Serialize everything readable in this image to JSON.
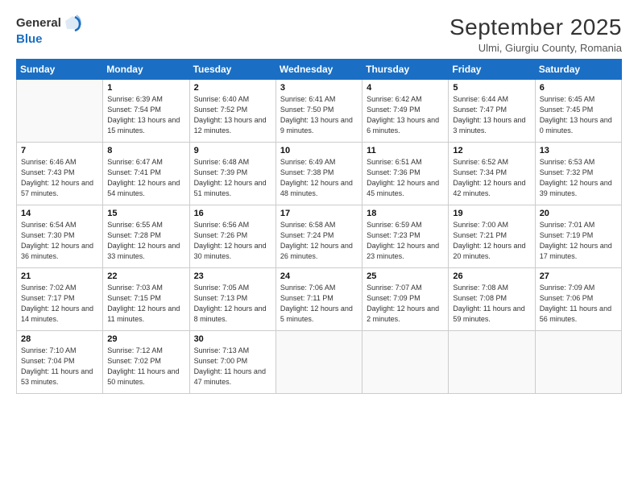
{
  "logo": {
    "general": "General",
    "blue": "Blue"
  },
  "title": {
    "month": "September 2025",
    "location": "Ulmi, Giurgiu County, Romania"
  },
  "weekdays": [
    "Sunday",
    "Monday",
    "Tuesday",
    "Wednesday",
    "Thursday",
    "Friday",
    "Saturday"
  ],
  "weeks": [
    [
      {
        "day": "",
        "sunrise": "",
        "sunset": "",
        "daylight": ""
      },
      {
        "day": "1",
        "sunrise": "Sunrise: 6:39 AM",
        "sunset": "Sunset: 7:54 PM",
        "daylight": "Daylight: 13 hours and 15 minutes."
      },
      {
        "day": "2",
        "sunrise": "Sunrise: 6:40 AM",
        "sunset": "Sunset: 7:52 PM",
        "daylight": "Daylight: 13 hours and 12 minutes."
      },
      {
        "day": "3",
        "sunrise": "Sunrise: 6:41 AM",
        "sunset": "Sunset: 7:50 PM",
        "daylight": "Daylight: 13 hours and 9 minutes."
      },
      {
        "day": "4",
        "sunrise": "Sunrise: 6:42 AM",
        "sunset": "Sunset: 7:49 PM",
        "daylight": "Daylight: 13 hours and 6 minutes."
      },
      {
        "day": "5",
        "sunrise": "Sunrise: 6:44 AM",
        "sunset": "Sunset: 7:47 PM",
        "daylight": "Daylight: 13 hours and 3 minutes."
      },
      {
        "day": "6",
        "sunrise": "Sunrise: 6:45 AM",
        "sunset": "Sunset: 7:45 PM",
        "daylight": "Daylight: 13 hours and 0 minutes."
      }
    ],
    [
      {
        "day": "7",
        "sunrise": "Sunrise: 6:46 AM",
        "sunset": "Sunset: 7:43 PM",
        "daylight": "Daylight: 12 hours and 57 minutes."
      },
      {
        "day": "8",
        "sunrise": "Sunrise: 6:47 AM",
        "sunset": "Sunset: 7:41 PM",
        "daylight": "Daylight: 12 hours and 54 minutes."
      },
      {
        "day": "9",
        "sunrise": "Sunrise: 6:48 AM",
        "sunset": "Sunset: 7:39 PM",
        "daylight": "Daylight: 12 hours and 51 minutes."
      },
      {
        "day": "10",
        "sunrise": "Sunrise: 6:49 AM",
        "sunset": "Sunset: 7:38 PM",
        "daylight": "Daylight: 12 hours and 48 minutes."
      },
      {
        "day": "11",
        "sunrise": "Sunrise: 6:51 AM",
        "sunset": "Sunset: 7:36 PM",
        "daylight": "Daylight: 12 hours and 45 minutes."
      },
      {
        "day": "12",
        "sunrise": "Sunrise: 6:52 AM",
        "sunset": "Sunset: 7:34 PM",
        "daylight": "Daylight: 12 hours and 42 minutes."
      },
      {
        "day": "13",
        "sunrise": "Sunrise: 6:53 AM",
        "sunset": "Sunset: 7:32 PM",
        "daylight": "Daylight: 12 hours and 39 minutes."
      }
    ],
    [
      {
        "day": "14",
        "sunrise": "Sunrise: 6:54 AM",
        "sunset": "Sunset: 7:30 PM",
        "daylight": "Daylight: 12 hours and 36 minutes."
      },
      {
        "day": "15",
        "sunrise": "Sunrise: 6:55 AM",
        "sunset": "Sunset: 7:28 PM",
        "daylight": "Daylight: 12 hours and 33 minutes."
      },
      {
        "day": "16",
        "sunrise": "Sunrise: 6:56 AM",
        "sunset": "Sunset: 7:26 PM",
        "daylight": "Daylight: 12 hours and 30 minutes."
      },
      {
        "day": "17",
        "sunrise": "Sunrise: 6:58 AM",
        "sunset": "Sunset: 7:24 PM",
        "daylight": "Daylight: 12 hours and 26 minutes."
      },
      {
        "day": "18",
        "sunrise": "Sunrise: 6:59 AM",
        "sunset": "Sunset: 7:23 PM",
        "daylight": "Daylight: 12 hours and 23 minutes."
      },
      {
        "day": "19",
        "sunrise": "Sunrise: 7:00 AM",
        "sunset": "Sunset: 7:21 PM",
        "daylight": "Daylight: 12 hours and 20 minutes."
      },
      {
        "day": "20",
        "sunrise": "Sunrise: 7:01 AM",
        "sunset": "Sunset: 7:19 PM",
        "daylight": "Daylight: 12 hours and 17 minutes."
      }
    ],
    [
      {
        "day": "21",
        "sunrise": "Sunrise: 7:02 AM",
        "sunset": "Sunset: 7:17 PM",
        "daylight": "Daylight: 12 hours and 14 minutes."
      },
      {
        "day": "22",
        "sunrise": "Sunrise: 7:03 AM",
        "sunset": "Sunset: 7:15 PM",
        "daylight": "Daylight: 12 hours and 11 minutes."
      },
      {
        "day": "23",
        "sunrise": "Sunrise: 7:05 AM",
        "sunset": "Sunset: 7:13 PM",
        "daylight": "Daylight: 12 hours and 8 minutes."
      },
      {
        "day": "24",
        "sunrise": "Sunrise: 7:06 AM",
        "sunset": "Sunset: 7:11 PM",
        "daylight": "Daylight: 12 hours and 5 minutes."
      },
      {
        "day": "25",
        "sunrise": "Sunrise: 7:07 AM",
        "sunset": "Sunset: 7:09 PM",
        "daylight": "Daylight: 12 hours and 2 minutes."
      },
      {
        "day": "26",
        "sunrise": "Sunrise: 7:08 AM",
        "sunset": "Sunset: 7:08 PM",
        "daylight": "Daylight: 11 hours and 59 minutes."
      },
      {
        "day": "27",
        "sunrise": "Sunrise: 7:09 AM",
        "sunset": "Sunset: 7:06 PM",
        "daylight": "Daylight: 11 hours and 56 minutes."
      }
    ],
    [
      {
        "day": "28",
        "sunrise": "Sunrise: 7:10 AM",
        "sunset": "Sunset: 7:04 PM",
        "daylight": "Daylight: 11 hours and 53 minutes."
      },
      {
        "day": "29",
        "sunrise": "Sunrise: 7:12 AM",
        "sunset": "Sunset: 7:02 PM",
        "daylight": "Daylight: 11 hours and 50 minutes."
      },
      {
        "day": "30",
        "sunrise": "Sunrise: 7:13 AM",
        "sunset": "Sunset: 7:00 PM",
        "daylight": "Daylight: 11 hours and 47 minutes."
      },
      {
        "day": "",
        "sunrise": "",
        "sunset": "",
        "daylight": ""
      },
      {
        "day": "",
        "sunrise": "",
        "sunset": "",
        "daylight": ""
      },
      {
        "day": "",
        "sunrise": "",
        "sunset": "",
        "daylight": ""
      },
      {
        "day": "",
        "sunrise": "",
        "sunset": "",
        "daylight": ""
      }
    ]
  ]
}
